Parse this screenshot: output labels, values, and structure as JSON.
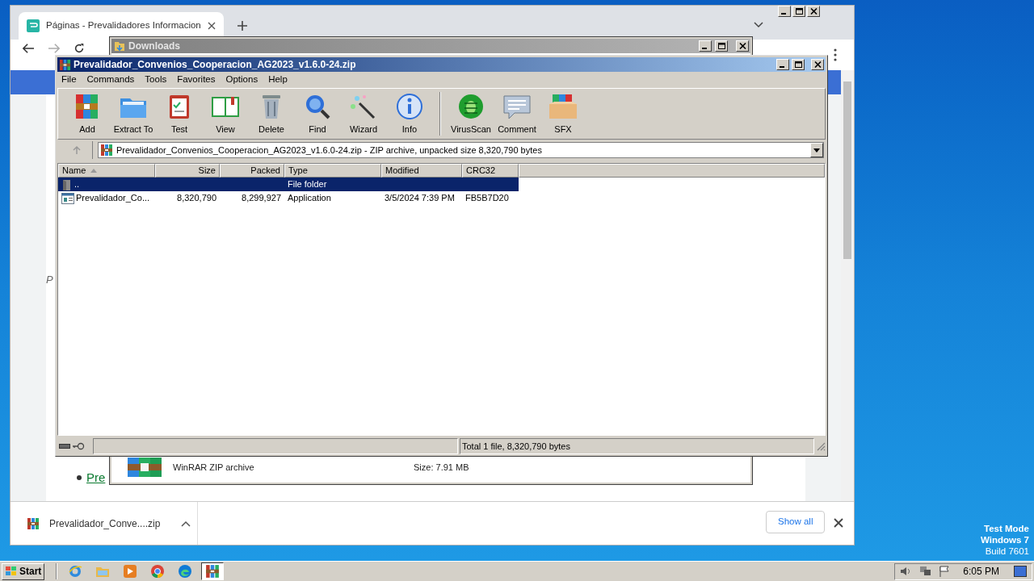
{
  "browser": {
    "tab_title": "Páginas - Prevalidadores Informacion",
    "page": {
      "italic_text": "P",
      "link_text": "Pre"
    },
    "download_bar": {
      "file": "Prevalidador_Conve....zip",
      "show_all": "Show all"
    }
  },
  "downloads_window": {
    "title": "Downloads",
    "file_type": "WinRAR ZIP archive",
    "size": "Size: 7.91 MB"
  },
  "winrar": {
    "title": "Prevalidador_Convenios_Cooperacion_AG2023_v1.6.0-24.zip",
    "menu": [
      "File",
      "Commands",
      "Tools",
      "Favorites",
      "Options",
      "Help"
    ],
    "toolbar_groups": [
      {
        "buttons": [
          {
            "label": "Add",
            "kind": "add"
          },
          {
            "label": "Extract To",
            "kind": "extract"
          },
          {
            "label": "Test",
            "kind": "test"
          },
          {
            "label": "View",
            "kind": "view"
          },
          {
            "label": "Delete",
            "kind": "delete"
          },
          {
            "label": "Find",
            "kind": "find"
          },
          {
            "label": "Wizard",
            "kind": "wizard"
          },
          {
            "label": "Info",
            "kind": "info"
          }
        ]
      },
      {
        "buttons": [
          {
            "label": "VirusScan",
            "kind": "virusscan"
          },
          {
            "label": "Comment",
            "kind": "comment"
          },
          {
            "label": "SFX",
            "kind": "sfx"
          }
        ]
      }
    ],
    "address": "Prevalidador_Convenios_Cooperacion_AG2023_v1.6.0-24.zip - ZIP archive, unpacked size 8,320,790 bytes",
    "columns": [
      {
        "label": "Name",
        "sorted": true
      },
      {
        "label": "Size",
        "sorted": false
      },
      {
        "label": "Packed",
        "sorted": false
      },
      {
        "label": "Type",
        "sorted": false
      },
      {
        "label": "Modified",
        "sorted": false
      },
      {
        "label": "CRC32",
        "sorted": false
      }
    ],
    "rows": [
      {
        "kind": "folder",
        "selected": true,
        "name": "..",
        "type": "File folder"
      },
      {
        "kind": "application",
        "selected": false,
        "name": "Prevalidador_Co...",
        "size": "8,320,790",
        "packed": "8,299,927",
        "type": "Application",
        "modified": "3/5/2024 7:39 PM",
        "crc32": "FB5B7D20"
      }
    ],
    "status": "Total 1 file, 8,320,790 bytes"
  },
  "desktop": {
    "notice": [
      "Test Mode",
      "Windows 7",
      "Build 7601"
    ]
  },
  "taskbar": {
    "start": "Start",
    "apps": [
      {
        "kind": "ie",
        "selected": false
      },
      {
        "kind": "explorer",
        "selected": false
      },
      {
        "kind": "media",
        "selected": false
      },
      {
        "kind": "chrome",
        "selected": false
      },
      {
        "kind": "edge",
        "selected": false
      },
      {
        "kind": "winrar",
        "selected": true
      }
    ],
    "clock": "6:05 PM"
  }
}
